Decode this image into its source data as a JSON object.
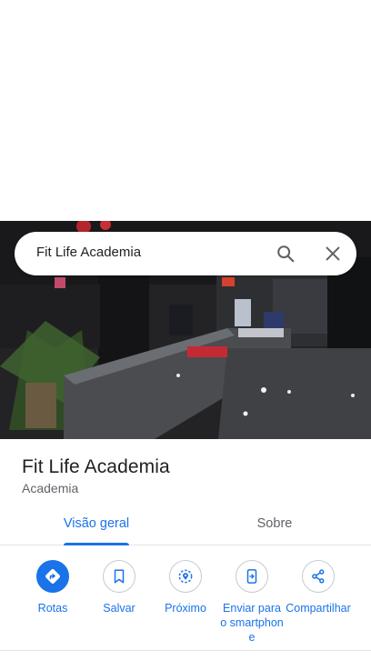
{
  "search": {
    "query": "Fit Life Academia"
  },
  "place": {
    "name": "Fit Life Academia",
    "category": "Academia"
  },
  "tabs": [
    {
      "label": "Visão geral",
      "active": true
    },
    {
      "label": "Sobre",
      "active": false
    }
  ],
  "actions": [
    {
      "label": "Rotas",
      "icon": "directions-icon"
    },
    {
      "label": "Salvar",
      "icon": "bookmark-icon"
    },
    {
      "label": "Próximo",
      "icon": "nearby-icon"
    },
    {
      "label": "Enviar para o smartphone",
      "icon": "send-to-phone-icon"
    },
    {
      "label": "Compartilhar",
      "icon": "share-icon"
    }
  ],
  "colors": {
    "accent": "#1a73e8",
    "text": "#202124",
    "secondary": "#5f6368"
  }
}
